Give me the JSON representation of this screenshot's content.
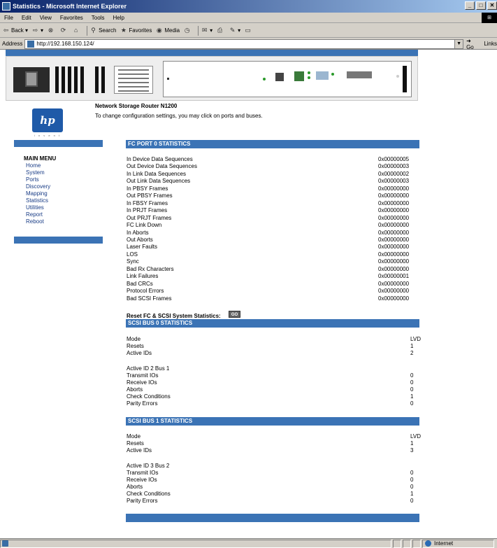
{
  "window": {
    "title": "Statistics - Microsoft Internet Explorer",
    "controls": [
      "_",
      "□",
      "✕"
    ]
  },
  "menubar": [
    "File",
    "Edit",
    "View",
    "Favorites",
    "Tools",
    "Help"
  ],
  "toolbar": {
    "back": "Back",
    "search": "Search",
    "favorites": "Favorites",
    "media": "Media"
  },
  "address": {
    "label": "Address",
    "url": "http://192.168.150.124/",
    "go": "Go",
    "links": "Links"
  },
  "status": {
    "zone": "Internet"
  },
  "page": {
    "logo_text": "hp",
    "logo_tagline": "i n v e n t",
    "product_title": "Network Storage Router N1200",
    "product_subtitle": "To change configuration settings, you may click on ports and buses."
  },
  "sidebar": {
    "title": "MAIN MENU",
    "items": [
      "Home",
      "System",
      "Ports",
      "Discovery",
      "Mapping",
      "Statistics",
      "Utilities",
      "Report",
      "Reboot"
    ]
  },
  "fc_port0": {
    "heading": "FC PORT 0 STATISTICS",
    "rows": [
      {
        "label": "In Device Data Sequences",
        "value": "0x00000005"
      },
      {
        "label": "Out Device Data Sequences",
        "value": "0x00000003"
      },
      {
        "label": "In Link Data Sequences",
        "value": "0x00000002"
      },
      {
        "label": "Out Link Data Sequences",
        "value": "0x00000003"
      },
      {
        "label": "In PBSY Frames",
        "value": "0x00000000"
      },
      {
        "label": "Out PBSY Frames",
        "value": "0x00000000"
      },
      {
        "label": "In FBSY Frames",
        "value": "0x00000000"
      },
      {
        "label": "In PRJT Frames",
        "value": "0x00000000"
      },
      {
        "label": "Out PRJT Frames",
        "value": "0x00000000"
      },
      {
        "label": "FC Link Down",
        "value": "0x00000000"
      },
      {
        "label": "In Aborts",
        "value": "0x00000000"
      },
      {
        "label": "Out Aborts",
        "value": "0x00000000"
      },
      {
        "label": "Laser Faults",
        "value": "0x00000000"
      },
      {
        "label": "LOS",
        "value": "0x00000000"
      },
      {
        "label": "Sync",
        "value": "0x00000000"
      },
      {
        "label": "Bad Rx Characters",
        "value": "0x00000000"
      },
      {
        "label": "Link Failures",
        "value": "0x00000001"
      },
      {
        "label": "Bad CRCs",
        "value": "0x00000000"
      },
      {
        "label": "Protocol Errors",
        "value": "0x00000000"
      },
      {
        "label": "Bad SCSI Frames",
        "value": "0x00000000"
      }
    ]
  },
  "reset": {
    "label": "Reset FC & SCSI System Statistics:",
    "button": "GO"
  },
  "scsi_bus0": {
    "heading": "SCSI BUS 0 STATISTICS",
    "summary": [
      {
        "label": "Mode",
        "value": "LVD"
      },
      {
        "label": "Resets",
        "value": "1"
      },
      {
        "label": "Active IDs",
        "value": "2"
      }
    ],
    "id_heading": "Active ID 2 Bus 1",
    "details": [
      {
        "label": "Transmit IOs",
        "value": "0"
      },
      {
        "label": "Receive IOs",
        "value": "0"
      },
      {
        "label": "Aborts",
        "value": "0"
      },
      {
        "label": "Check Conditions",
        "value": "1"
      },
      {
        "label": "Parity Errors",
        "value": "0"
      }
    ]
  },
  "scsi_bus1": {
    "heading": "SCSI BUS 1 STATISTICS",
    "summary": [
      {
        "label": "Mode",
        "value": "LVD"
      },
      {
        "label": "Resets",
        "value": "1"
      },
      {
        "label": "Active IDs",
        "value": "3"
      }
    ],
    "id_heading": "Active ID 3 Bus 2",
    "details": [
      {
        "label": "Transmit IOs",
        "value": "0"
      },
      {
        "label": "Receive IOs",
        "value": "0"
      },
      {
        "label": "Aborts",
        "value": "0"
      },
      {
        "label": "Check Conditions",
        "value": "1"
      },
      {
        "label": "Parity Errors",
        "value": "0"
      }
    ]
  }
}
